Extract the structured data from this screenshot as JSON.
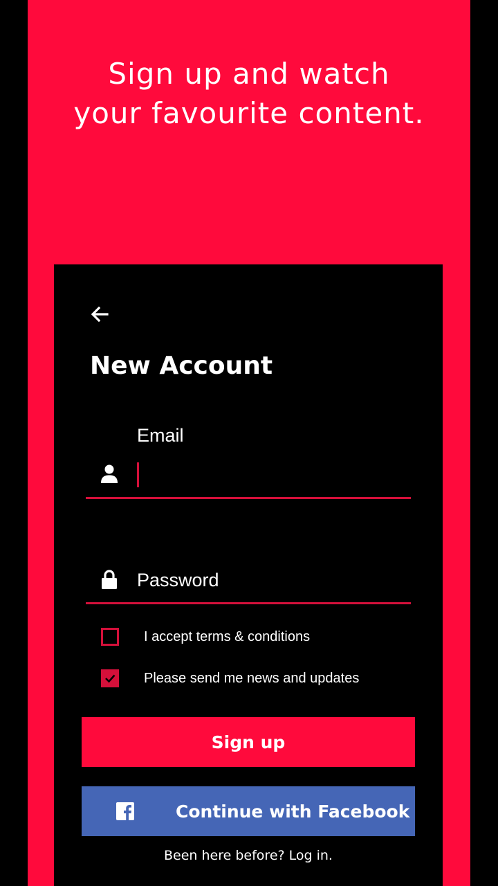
{
  "hero": {
    "line1": "Sign up and watch",
    "line2": "your favourite content."
  },
  "form": {
    "back_icon": "arrow-left-icon",
    "title": "New Account",
    "email": {
      "label": "Email",
      "value": "",
      "icon": "user-icon"
    },
    "password": {
      "placeholder": "Password",
      "value": "",
      "icon": "lock-icon"
    },
    "checkboxes": [
      {
        "label": "I accept terms & conditions",
        "checked": false
      },
      {
        "label": "Please send me news and updates",
        "checked": true
      }
    ],
    "signup_label": "Sign up",
    "facebook_label": "Continue with Facebook",
    "facebook_icon": "facebook-icon",
    "login_text": "Been here before? Log in."
  },
  "colors": {
    "brand_red": "#ff0a3c",
    "accent_red": "#d4103a",
    "facebook_blue": "#4566b6",
    "card_bg": "#000000"
  }
}
